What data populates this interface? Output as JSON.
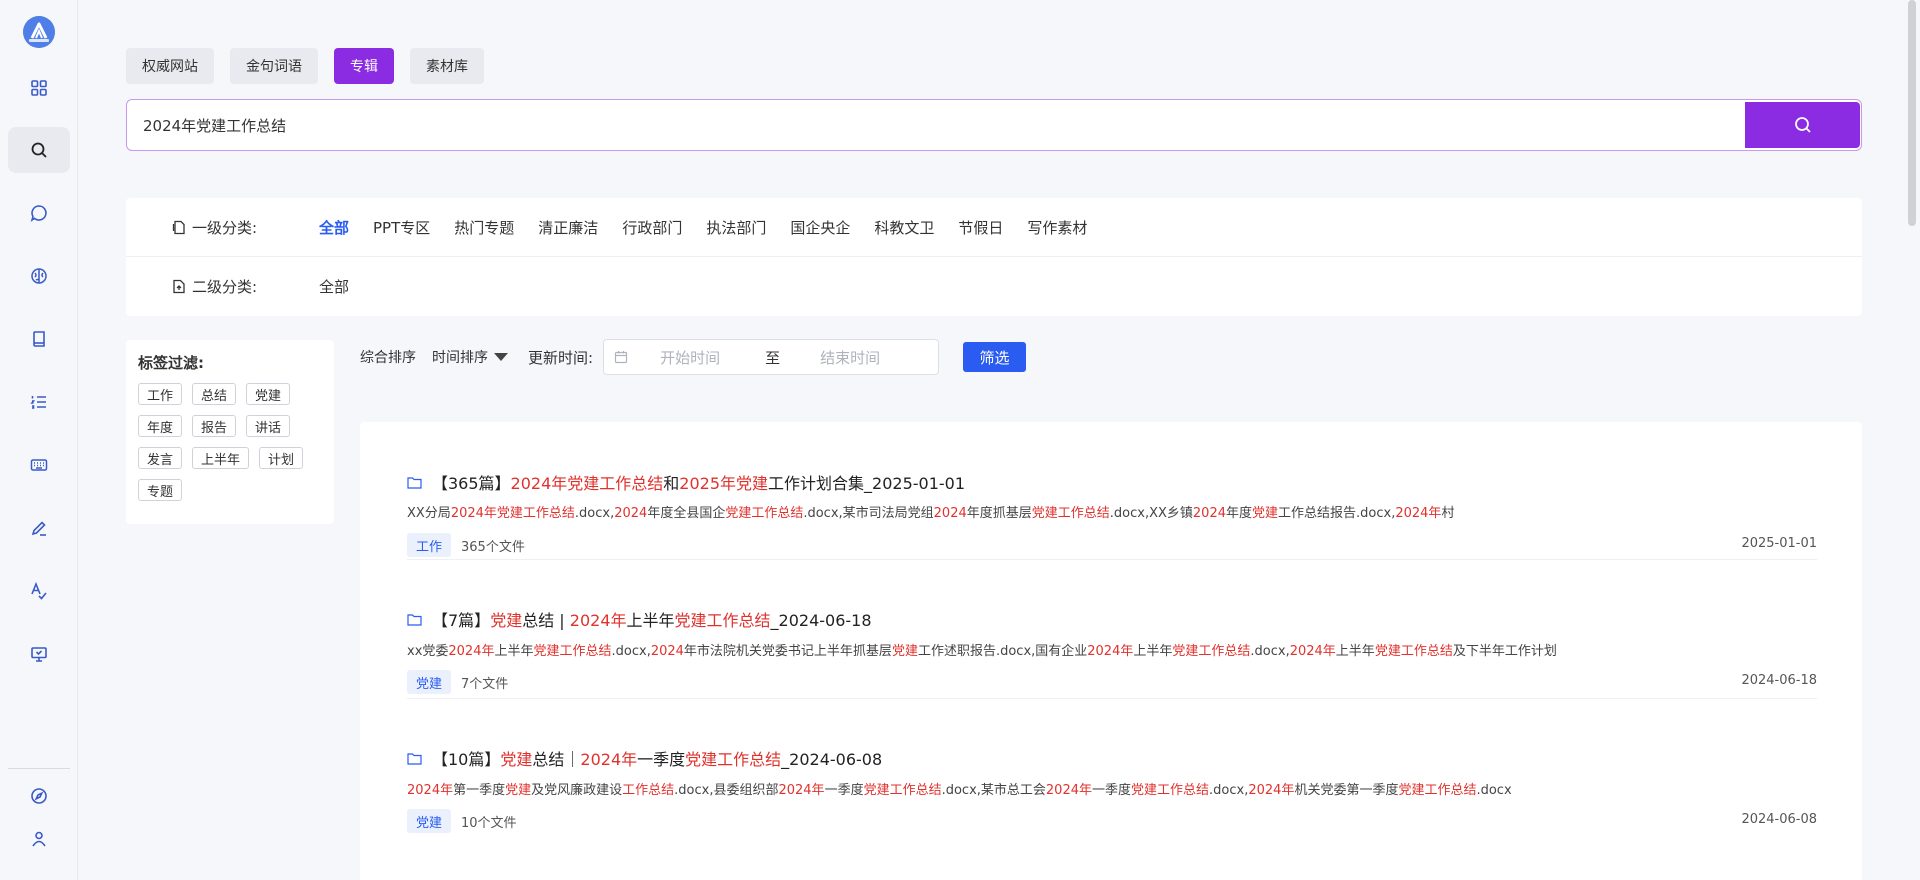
{
  "sidebar": {
    "logo_text": "",
    "items": [
      {
        "name": "grid-icon",
        "active": false
      },
      {
        "name": "search-icon",
        "active": true
      },
      {
        "name": "chat-icon",
        "active": false
      },
      {
        "name": "brain-icon",
        "active": false
      },
      {
        "name": "book-icon",
        "active": false
      },
      {
        "name": "list-icon",
        "active": false
      },
      {
        "name": "keyboard-icon",
        "active": false
      },
      {
        "name": "pen-icon",
        "active": false
      },
      {
        "name": "spell-check-icon",
        "active": false
      },
      {
        "name": "presentation-icon",
        "active": false
      },
      {
        "name": "compass-icon",
        "active": false
      },
      {
        "name": "user-icon",
        "active": false
      }
    ]
  },
  "tabs": [
    "权威网站",
    "金句词语",
    "专辑",
    "素材库"
  ],
  "active_tab": "专辑",
  "search": {
    "value": "2024年党建工作总结",
    "button_icon": "search-icon"
  },
  "categories": {
    "level1_label": "一级分类:",
    "level1_items": [
      "全部",
      "PPT专区",
      "热门专题",
      "清正廉洁",
      "行政部门",
      "执法部门",
      "国企央企",
      "科教文卫",
      "节假日",
      "写作素材"
    ],
    "level1_active": "全部",
    "level2_label": "二级分类:",
    "level2_items": [
      "全部"
    ]
  },
  "tag_filter": {
    "title": "标签过滤:",
    "tags": [
      "工作",
      "总结",
      "党建",
      "年度",
      "报告",
      "讲话",
      "发言",
      "上半年",
      "计划",
      "专题"
    ]
  },
  "toolbar": {
    "sort_general": "综合排序",
    "sort_time": "时间排序",
    "date_label": "更新时间:",
    "start_placeholder": "开始时间",
    "separator": "至",
    "end_placeholder": "结束时间",
    "filter_button": "筛选"
  },
  "results": [
    {
      "title": [
        [
          "【365篇】",
          false
        ],
        [
          "2024年党建工作总结",
          true
        ],
        [
          "和",
          false
        ],
        [
          "2025年党建",
          true
        ],
        [
          "工作计划合集_2025-01-01",
          false
        ]
      ],
      "desc": [
        [
          "XX分局",
          false
        ],
        [
          "2024年党建工作总结",
          true
        ],
        [
          ".docx,",
          false
        ],
        [
          "2024",
          true
        ],
        [
          "年度全县国企",
          false
        ],
        [
          "党建工作总结",
          true
        ],
        [
          ".docx,某市司法局党组",
          false
        ],
        [
          "2024",
          true
        ],
        [
          "年度抓基层",
          false
        ],
        [
          "党建工作总结",
          true
        ],
        [
          ".docx,XX乡镇",
          false
        ],
        [
          "2024",
          true
        ],
        [
          "年度",
          false
        ],
        [
          "党建",
          true
        ],
        [
          "工作总结报告.docx,",
          false
        ],
        [
          "2024年",
          true
        ],
        [
          "村",
          false
        ]
      ],
      "tag": "工作",
      "count": "365个文件",
      "date": "2025-01-01"
    },
    {
      "title": [
        [
          "【7篇】",
          false
        ],
        [
          "党建",
          true
        ],
        [
          "总结 | ",
          false
        ],
        [
          "2024年",
          true
        ],
        [
          "上半年",
          false
        ],
        [
          "党建工作总结",
          true
        ],
        [
          "_2024-06-18",
          false
        ]
      ],
      "desc": [
        [
          "xx党委",
          false
        ],
        [
          "2024年",
          true
        ],
        [
          "上半年",
          false
        ],
        [
          "党建工作总结",
          true
        ],
        [
          ".docx,",
          false
        ],
        [
          "2024",
          true
        ],
        [
          "年市法院机关党委书记上半年抓基层",
          false
        ],
        [
          "党建",
          true
        ],
        [
          "工作述职报告.docx,国有企业",
          false
        ],
        [
          "2024年",
          true
        ],
        [
          "上半年",
          false
        ],
        [
          "党建工作总结",
          true
        ],
        [
          ".docx,",
          false
        ],
        [
          "2024年",
          true
        ],
        [
          "上半年",
          false
        ],
        [
          "党建工作总结",
          true
        ],
        [
          "及下半年工作计划",
          false
        ]
      ],
      "tag": "党建",
      "count": "7个文件",
      "date": "2024-06-18"
    },
    {
      "title": [
        [
          "【10篇】",
          false
        ],
        [
          "党建",
          true
        ],
        [
          "总结｜",
          false
        ],
        [
          "2024年",
          true
        ],
        [
          "一季度",
          false
        ],
        [
          "党建工作总结",
          true
        ],
        [
          "_2024-06-08",
          false
        ]
      ],
      "desc": [
        [
          "2024年",
          true
        ],
        [
          "第一季度",
          false
        ],
        [
          "党建",
          true
        ],
        [
          "及党风廉政建设",
          false
        ],
        [
          "工作总结",
          true
        ],
        [
          ".docx,县委组织部",
          false
        ],
        [
          "2024年",
          true
        ],
        [
          "一季度",
          false
        ],
        [
          "党建工作总结",
          true
        ],
        [
          ".docx,某市总工会",
          false
        ],
        [
          "2024年",
          true
        ],
        [
          "一季度",
          false
        ],
        [
          "党建工作总结",
          true
        ],
        [
          ".docx,",
          false
        ],
        [
          "2024年",
          true
        ],
        [
          "机关党委第一季度",
          false
        ],
        [
          "党建工作总结",
          true
        ],
        [
          ".docx",
          false
        ]
      ],
      "tag": "党建",
      "count": "10个文件",
      "date": "2024-06-08"
    }
  ],
  "colors": {
    "accent": "#8b2be2",
    "link": "#2b5cf2",
    "highlight": "#e0322d"
  }
}
